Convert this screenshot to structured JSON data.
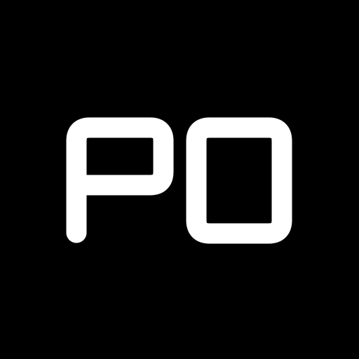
{
  "logo": {
    "text": "PO",
    "foreground": "#ffffff",
    "background": "#000000"
  }
}
